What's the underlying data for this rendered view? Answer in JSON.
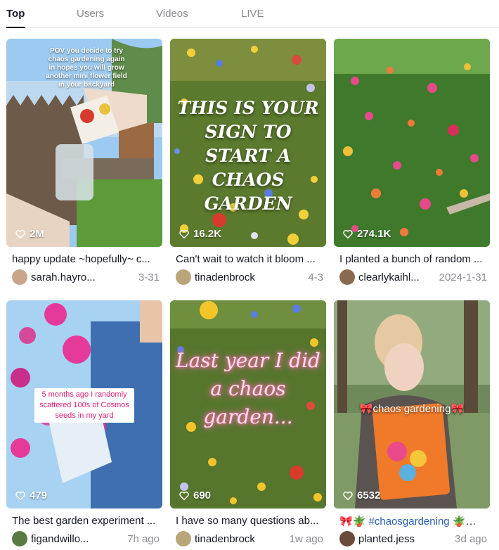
{
  "tabs": [
    {
      "label": "Top",
      "active": true
    },
    {
      "label": "Users",
      "active": false
    },
    {
      "label": "Videos",
      "active": false
    },
    {
      "label": "LIVE",
      "active": false
    }
  ],
  "videos": [
    {
      "overlay_text": "POV you decide to try chaos gardening again in hopes you will grow another mini flower field in your backyard",
      "likes": "2M",
      "caption": "happy update ~hopefully~ c...",
      "username": "sarah.hayro...",
      "date": "3-31"
    },
    {
      "overlay_text": "THIS IS YOUR SIGN TO START A CHAOS GARDEN",
      "likes": "16.2K",
      "caption": "Can't wait to watch it bloom ...",
      "username": "tinadenbrock",
      "date": "4-3"
    },
    {
      "overlay_text": "",
      "likes": "274.1K",
      "caption": "I planted a bunch of random ...",
      "username": "clearlykaihl...",
      "date": "2024-1-31"
    },
    {
      "overlay_text": "5 months ago I randomly scattered 100s of Cosmos seeds in my yard",
      "likes": "479",
      "caption": "The best garden experiment ...",
      "username": "figandwillo...",
      "date": "7h ago"
    },
    {
      "overlay_text": "Last year I did a chaos garden...",
      "likes": "690",
      "caption": "I have so many questions ab...",
      "username": "tinadenbrock",
      "date": "1w ago"
    },
    {
      "overlay_text": "🎀chaos gardening🎀",
      "likes": "6532",
      "caption_prefix": "🎀🪴 ",
      "caption_tag": "#chaosgardening",
      "caption_suffix": " 🪴🎀 ...",
      "username": "planted.jess",
      "date": "3d ago"
    }
  ],
  "icons": {
    "likes": "heart-outline-icon"
  },
  "colors": {
    "text": "#161823",
    "muted": "#8a8b91",
    "hashtag": "#2b5db9",
    "overlay_pink": "#e0207a"
  }
}
